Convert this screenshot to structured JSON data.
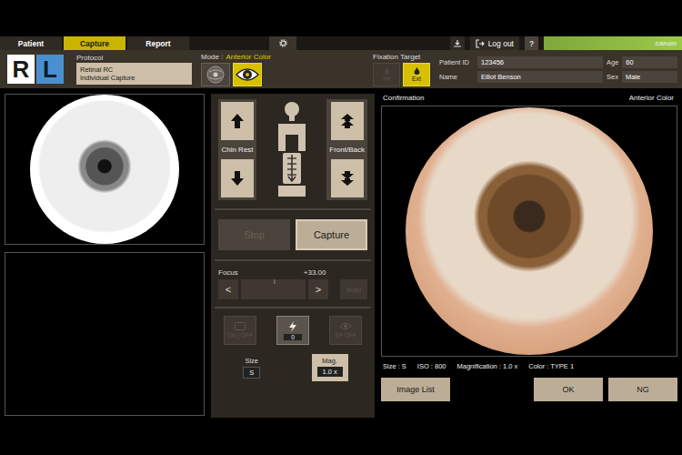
{
  "tabs": [
    {
      "label": "Patient",
      "selected": false
    },
    {
      "label": "Capture",
      "selected": true
    },
    {
      "label": "Report",
      "selected": false
    }
  ],
  "toolbar": {
    "log_out": "Log out",
    "help": "?",
    "brand": "canon"
  },
  "eyes": [
    {
      "label": "R",
      "selected": false
    },
    {
      "label": "L",
      "selected": true
    }
  ],
  "protocol": {
    "label": "Protocol",
    "lines": [
      "Retinal RC",
      "Individual Capture"
    ]
  },
  "mode": {
    "label": "Mode :",
    "value": "Anterior Color",
    "options": [
      {
        "kind": "fundus",
        "selected": false
      },
      {
        "kind": "anterior",
        "selected": true
      }
    ]
  },
  "fixation": {
    "label": "Fixation Target",
    "options": [
      {
        "label": "Int",
        "selected": false,
        "disabled": true
      },
      {
        "label": "Ext",
        "selected": true,
        "disabled": false
      }
    ]
  },
  "patient": {
    "fields": [
      {
        "label": "Patient ID",
        "value": "123456"
      },
      {
        "label": "Age",
        "value": "60"
      },
      {
        "label": "Name",
        "value": "Elliot Benson"
      },
      {
        "label": "Sex",
        "value": "Male"
      }
    ]
  },
  "movement": [
    {
      "label": "Chin Rest"
    },
    {
      "label": "Front/Back"
    }
  ],
  "capture_buttons": [
    {
      "label": "Stop",
      "disabled": true
    },
    {
      "label": "Capture",
      "disabled": false
    }
  ],
  "focus": {
    "label": "Focus",
    "reading": "+33.00",
    "level": 0.5,
    "prev": "<",
    "next": ">",
    "auto": "Auto",
    "auto_disabled": true
  },
  "options": [
    {
      "kind": "toggle",
      "label": "ON | OFF",
      "disabled": true
    },
    {
      "kind": "flash",
      "label": "0",
      "disabled": false
    },
    {
      "kind": "eye",
      "label": "SP OFF",
      "disabled": true
    }
  ],
  "size": {
    "label": "Size",
    "value": "S"
  },
  "mag": {
    "label": "Mag.",
    "value": "1.0 x"
  },
  "confirmation": {
    "title": "Confirmation",
    "mode": "Anterior Color",
    "info": [
      "Size : S",
      "ISO : 800",
      "Magnification : 1.0 x",
      "Color : TYPE 1"
    ],
    "buttons": [
      {
        "label": "Image List"
      },
      {
        "label": "OK"
      },
      {
        "label": "NG"
      }
    ]
  }
}
